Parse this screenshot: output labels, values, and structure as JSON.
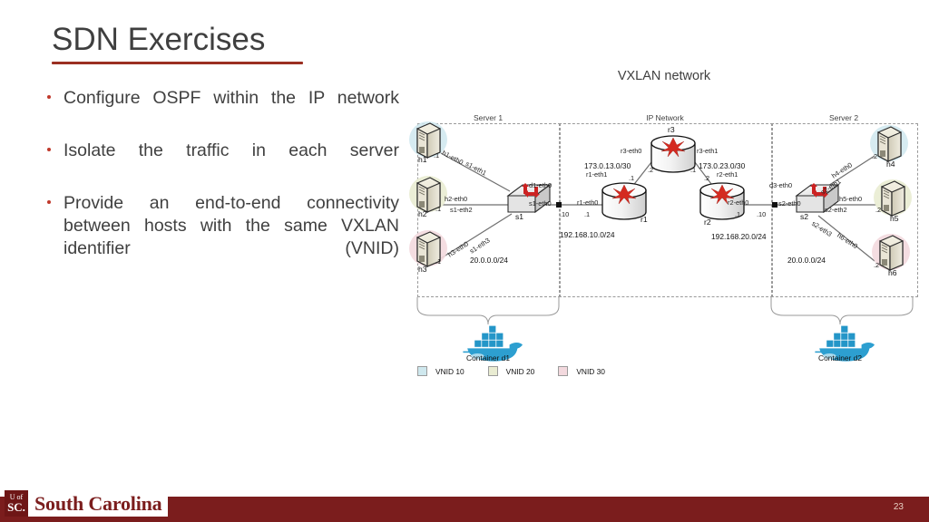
{
  "slide": {
    "title": "SDN Exercises",
    "bullets": [
      "Configure OSPF within the IP network",
      "Isolate the traffic in each server",
      "Provide an end-to-end connectivity between hosts with the same VXLAN identifier (VNID)"
    ],
    "page_number": "23",
    "footer": {
      "logo_top": "U of",
      "logo_bottom": "SC.",
      "wordmark": "South Carolina",
      "bar_color": "#7b1d1d"
    },
    "accent_color": "#9b2f22"
  },
  "diagram": {
    "title": "VXLAN network",
    "zones": [
      {
        "label": "Server 1"
      },
      {
        "label": "IP Network"
      },
      {
        "label": "Server 2"
      }
    ],
    "subnets": {
      "server1": "20.0.0.0/24",
      "server2": "20.0.0.0/24",
      "r1_left": "192.168.10.0/24",
      "r2_right": "192.168.20.0/24",
      "r3_left": "173.0.13.0/30",
      "r3_right": "173.0.23.0/30"
    },
    "hosts": [
      {
        "name": "h1",
        "ip": ".1",
        "iface": "h1-eth0",
        "sw_iface": "s1-eth1",
        "vnid": "10",
        "color": "#cfe8ee"
      },
      {
        "name": "h2",
        "ip": ".1",
        "iface": "h2-eth0",
        "sw_iface": "s1-eth2",
        "vnid": "20",
        "color": "#e9ecd2"
      },
      {
        "name": "h3",
        "ip": ".1",
        "iface": "h3-eth0",
        "sw_iface": "s1-eth3",
        "vnid": "30",
        "color": "#f3d9de"
      },
      {
        "name": "h4",
        "ip": ".2",
        "iface": "h4-eth0",
        "sw_iface": "s2-eth1",
        "vnid": "10",
        "color": "#cfe8ee"
      },
      {
        "name": "h5",
        "ip": ".2",
        "iface": "h5-eth0",
        "sw_iface": "s2-eth2",
        "vnid": "20",
        "color": "#e9ecd2"
      },
      {
        "name": "h6",
        "ip": ".2",
        "iface": "h6-eth0",
        "sw_iface": "s2-eth3",
        "vnid": "30",
        "color": "#f3d9de"
      }
    ],
    "switches": [
      {
        "name": "s1",
        "uplink_iface": "s1-eth0",
        "uplink_ip": ".10",
        "docker_iface": "d1-eth0"
      },
      {
        "name": "s2",
        "uplink_iface": "s2-eth0",
        "uplink_ip": ".10",
        "docker_iface": "d3-eth0"
      }
    ],
    "routers": [
      {
        "name": "r1",
        "ifaces": [
          "r1-eth0",
          "r1-eth1"
        ],
        "ips": [
          ".1",
          ".1"
        ]
      },
      {
        "name": "r2",
        "ifaces": [
          "r2-eth0",
          "r2-eth1"
        ],
        "ips": [
          ".1",
          ".2"
        ]
      },
      {
        "name": "r3",
        "ifaces": [
          "r3-eth0",
          "r3-eth1"
        ],
        "ips": [
          ".2",
          ".1"
        ]
      }
    ],
    "containers": [
      {
        "label": "Container d1",
        "icon": "docker-whale-icon"
      },
      {
        "label": "Container d2",
        "icon": "docker-whale-icon"
      }
    ],
    "legend": [
      {
        "label": "VNID 10",
        "color": "#cfe8ee"
      },
      {
        "label": "VNID 20",
        "color": "#e9ecd2"
      },
      {
        "label": "VNID 30",
        "color": "#f3d9de"
      }
    ]
  }
}
